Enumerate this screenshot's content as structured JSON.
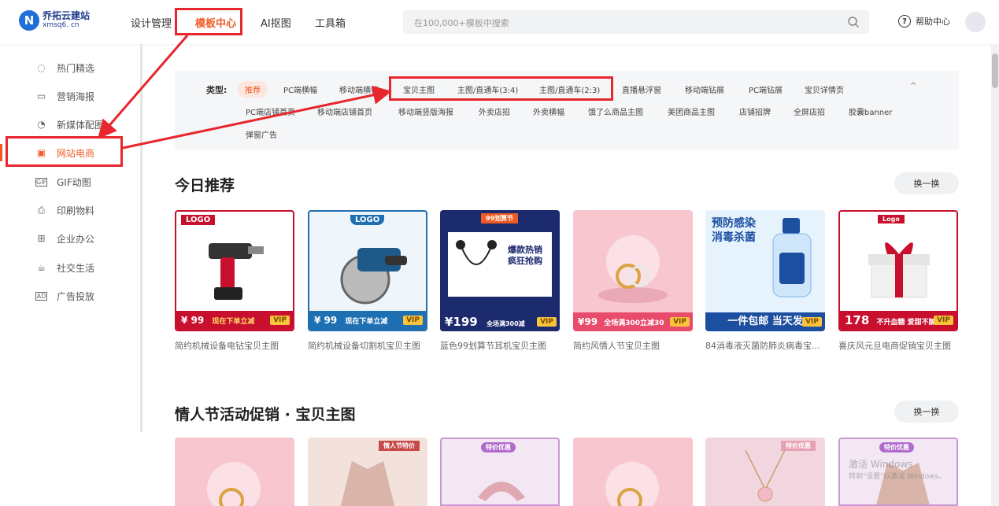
{
  "header": {
    "logo_name": "乔拓云建站",
    "logo_domain": "xmsq6. cn",
    "nav": [
      "设计管理",
      "模板中心",
      "AI抠图",
      "工具箱"
    ],
    "search_placeholder": "在100,000+模板中搜索",
    "help_label": "帮助中心"
  },
  "sidebar": {
    "items": [
      {
        "label": "热门精选",
        "icon": "flame-icon"
      },
      {
        "label": "营销海报",
        "icon": "poster-icon"
      },
      {
        "label": "新媒体配图",
        "icon": "chat-icon"
      },
      {
        "label": "网站电商",
        "icon": "shop-icon"
      },
      {
        "label": "GIF动图",
        "icon": "gif-icon"
      },
      {
        "label": "印刷物料",
        "icon": "print-icon"
      },
      {
        "label": "企业办公",
        "icon": "office-icon"
      },
      {
        "label": "社交生活",
        "icon": "cup-icon"
      },
      {
        "label": "广告投放",
        "icon": "ad-icon"
      }
    ]
  },
  "filter": {
    "type_label": "类型:",
    "row1": [
      "推荐",
      "PC端横幅",
      "移动端横幅",
      "宝贝主图",
      "主图/直通车(3:4)",
      "主图/直通车(2:3)",
      "直播悬浮窗",
      "移动端钻展",
      "PC端钻展",
      "宝贝详情页"
    ],
    "row2": [
      "PC端店铺首页",
      "移动端店铺首页",
      "移动端竖版海报",
      "外卖店招",
      "外卖横幅",
      "饿了么商品主图",
      "美团商品主图",
      "店铺招牌",
      "全屏店招",
      "胶囊banner"
    ],
    "row3": [
      "弹窗广告"
    ]
  },
  "sections": [
    {
      "title": "今日推荐",
      "swap_label": "换一换",
      "cards": [
        {
          "caption": "简约机械设备电钻宝贝主图",
          "top_text": "LOGO",
          "price": "¥ 99",
          "promo": "现在下单立减",
          "bg": "#ffffff",
          "banner_bg": "#c8102e"
        },
        {
          "caption": "简约机械设备切割机宝贝主图",
          "top_text": "LOGO",
          "price": "¥ 99",
          "promo": "现在下单立减",
          "bg": "#eef5fb",
          "banner_bg": "#1f6fb3"
        },
        {
          "caption": "蓝色99划算节耳机宝贝主图",
          "top_text": "99划算节",
          "price": "¥199",
          "promo": "全场满300减",
          "bg": "#1c2a6e",
          "banner_bg": "#1c2a6e"
        },
        {
          "caption": "简约风情人节宝贝主图",
          "top_text": "",
          "price": "¥99",
          "promo": "全场满300立减30",
          "bg": "#f7c6cf",
          "banner_bg": "#e84b6b"
        },
        {
          "caption": "84消毒液灭菌防肺炎病毒宝...",
          "top_text": "预防感染 消毒杀菌",
          "price": "一件包邮 当天发",
          "promo": "",
          "bg": "#e6f3fc",
          "banner_bg": "#1c4fa0"
        },
        {
          "caption": "喜庆风元旦电商促销宝贝主图",
          "top_text": "Logo",
          "price": "178",
          "promo": "不升血糖 爱甜不腻",
          "bg": "#ffffff",
          "banner_bg": "#c8102e"
        }
      ]
    },
    {
      "title": "情人节活动促销 · 宝贝主图",
      "swap_label": "换一换",
      "cards": [
        {
          "top_text": "",
          "bg": "#f7c6cf"
        },
        {
          "top_text": "情人节特价",
          "bg": "#f3e2dc"
        },
        {
          "top_text": "特价优惠",
          "bg": "#f4e7f4"
        },
        {
          "top_text": "",
          "bg": "#f7c6cf"
        },
        {
          "top_text": "特价优惠",
          "bg": "#f1d6e0"
        },
        {
          "top_text": "特价优惠",
          "bg": "#f4e7f4"
        }
      ]
    }
  ],
  "vip_label": "VIP",
  "watermark": {
    "line1": "激活 Windows",
    "line2": "转到\"设置\"以激活 Windows。"
  },
  "colors": {
    "accent": "#f05a24",
    "annotation_red": "#e8262d"
  }
}
